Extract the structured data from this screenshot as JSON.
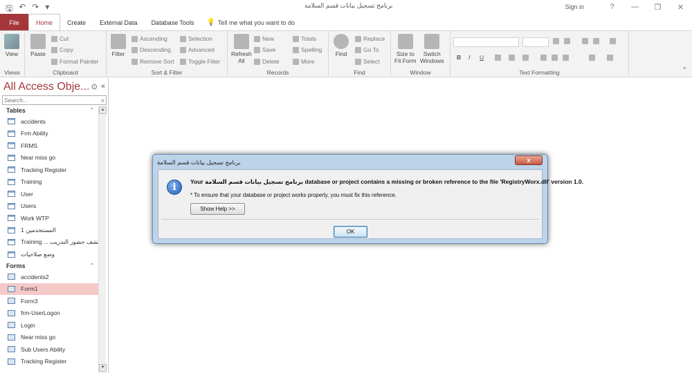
{
  "window": {
    "title": "برنامج تسجيل بيانات قسم السلامة",
    "sign_in": "Sign in",
    "help": "?",
    "minimize": "—",
    "restore": "❐",
    "close": "✕"
  },
  "qat": {
    "save": "🖫",
    "undo": "↶",
    "redo": "↷",
    "customize": "▾"
  },
  "tabs": {
    "file": "File",
    "home": "Home",
    "create": "Create",
    "external": "External Data",
    "dbtools": "Database Tools",
    "tell": "Tell me what you want to do"
  },
  "ribbon": {
    "views": {
      "label": "Views",
      "view": "View"
    },
    "clipboard": {
      "label": "Clipboard",
      "paste": "Paste",
      "cut": "Cut",
      "copy": "Copy",
      "format_painter": "Format Painter"
    },
    "sort_filter": {
      "label": "Sort & Filter",
      "filter": "Filter",
      "ascending": "Ascending",
      "descending": "Descending",
      "remove_sort": "Remove Sort",
      "selection": "Selection",
      "advanced": "Advanced",
      "toggle_filter": "Toggle Filter"
    },
    "records": {
      "label": "Records",
      "refresh": "Refresh",
      "refresh_all": "All",
      "new": "New",
      "save": "Save",
      "delete": "Delete",
      "totals": "Totals",
      "spelling": "Spelling",
      "more": "More"
    },
    "find": {
      "label": "Find",
      "find": "Find",
      "replace": "Replace",
      "goto": "Go To",
      "select": "Select"
    },
    "window": {
      "label": "Window",
      "size_to": "Size to",
      "fit_form": "Fit Form",
      "switch": "Switch",
      "windows": "Windows"
    },
    "text_formatting": {
      "label": "Text Formatting",
      "bold": "B",
      "italic": "I",
      "underline": "U"
    }
  },
  "nav": {
    "title": "All Access Obje...",
    "search_placeholder": "Search...",
    "tables_header": "Tables",
    "forms_header": "Forms",
    "tables": [
      "accidents",
      "Frm Ability",
      "FRMS",
      "Near miss go",
      "Tracking Register",
      "Training",
      "User",
      "Users",
      "Work WTP",
      "المستخدمين 1",
      "Training ... كشف حضور التدريب",
      "وضع صلاحيات"
    ],
    "forms": [
      "accidents2",
      "Form1",
      "Form3",
      "frm-UserLogon",
      "Login",
      "Near miss go",
      "Sub Users Ability",
      "Tracking Register"
    ]
  },
  "dialog": {
    "title": "برنامج تسجيل بيانات قسم السلامة",
    "close": "x",
    "message": "Your برنامج تسجيل بيانات قسم السلامة database or project contains a missing or broken reference to the file 'RegistryWorx.dll' version 1.0.",
    "sub_message": "* To ensure that your database or project works properly, you must fix this reference.",
    "show_help": "Show Help >>",
    "ok": "OK"
  },
  "colors": {
    "access_red": "#A4373A",
    "selected_row": "#f6c9c9"
  }
}
